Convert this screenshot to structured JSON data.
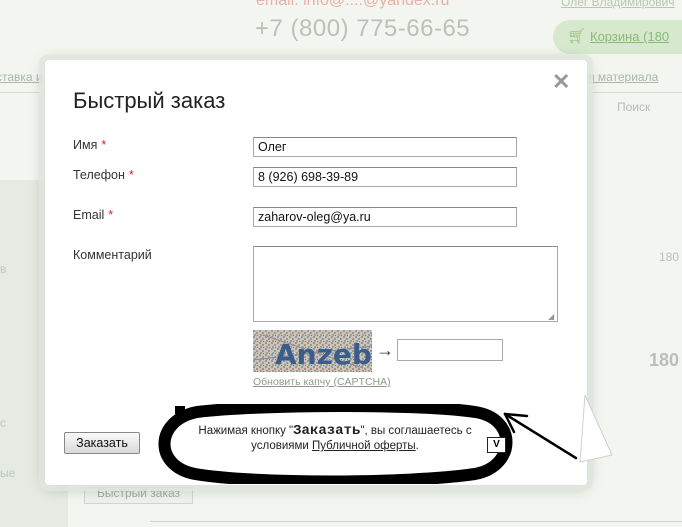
{
  "background": {
    "email": "email: info@....@yandex.ru",
    "phone": "+7 (800) 775-66-65",
    "user_name": "Олег Владимирович",
    "cart_label": "Корзина (180",
    "nav_left": "ставка и",
    "nav_right": "я материала",
    "search_label": "Поиск",
    "side_labels": [
      "в",
      "с",
      "ые"
    ],
    "price_small": "180",
    "price_big": "180",
    "footer_button": "Быстрый заказ"
  },
  "modal": {
    "title": "Быстрый заказ",
    "close_symbol": "✕",
    "fields": {
      "name": {
        "label": "Имя",
        "required_mark": "*",
        "value": "Олег"
      },
      "phone": {
        "label": "Телефон",
        "required_mark": "*",
        "value": "8 (926) 698-39-89"
      },
      "email": {
        "label": "Email",
        "required_mark": "*",
        "value": "zaharov-oleg@ya.ru"
      },
      "comment": {
        "label": "Комментарий",
        "value": ""
      }
    },
    "captcha": {
      "image_text": "Anzeb",
      "arrow": "→",
      "input_value": "",
      "refresh_link": "Обновить капчу (CAPTCHA)"
    },
    "submit_label": "Заказать",
    "consent": {
      "prefix": "Нажимая кнопку \"",
      "button_word": "Заказать",
      "middle": "\", вы соглашаетесь с условиями ",
      "link": "Публичной оферты",
      "suffix": "."
    },
    "v_button": "V"
  },
  "colors": {
    "required": "#dd2222",
    "link_muted": "#8b9b8b",
    "cart_bg": "#d6e9cc"
  }
}
